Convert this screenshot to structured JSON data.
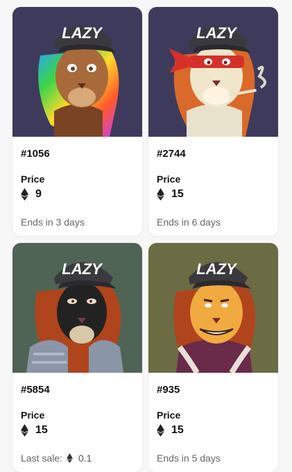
{
  "cards": [
    {
      "id": "#1056",
      "price_label": "Price",
      "price": "9",
      "footer": "Ends in 3 days",
      "bg": "#3e3a5c",
      "fur": "#8a5030",
      "mane": "rainbow",
      "face": "#a86a3a"
    },
    {
      "id": "#2744",
      "price_label": "Price",
      "price": "15",
      "footer": "Ends in 6 days",
      "bg": "#3e3a5c",
      "fur": "#e8e2cc",
      "mane": "#d96a2a",
      "face": "#f0e6cc",
      "accessory": "red-bandana"
    },
    {
      "id": "#5854",
      "price_label": "Price",
      "price": "15",
      "footer_label": "Last sale:",
      "footer_value": "0.1",
      "bg": "#4f6455",
      "fur": "#1a1a1a",
      "mane": "#b0441c",
      "face": "#222222",
      "accessory": "armor"
    },
    {
      "id": "#935",
      "price_label": "Price",
      "price": "15",
      "footer": "Ends in 5 days",
      "bg": "#6b6b44",
      "fur": "#e59a34",
      "mane": "#b0441c",
      "face": "#f0aa40",
      "accessory": "jacket"
    }
  ],
  "cap_text": "LAZY",
  "icons": {
    "currency": "ethereum-icon"
  }
}
